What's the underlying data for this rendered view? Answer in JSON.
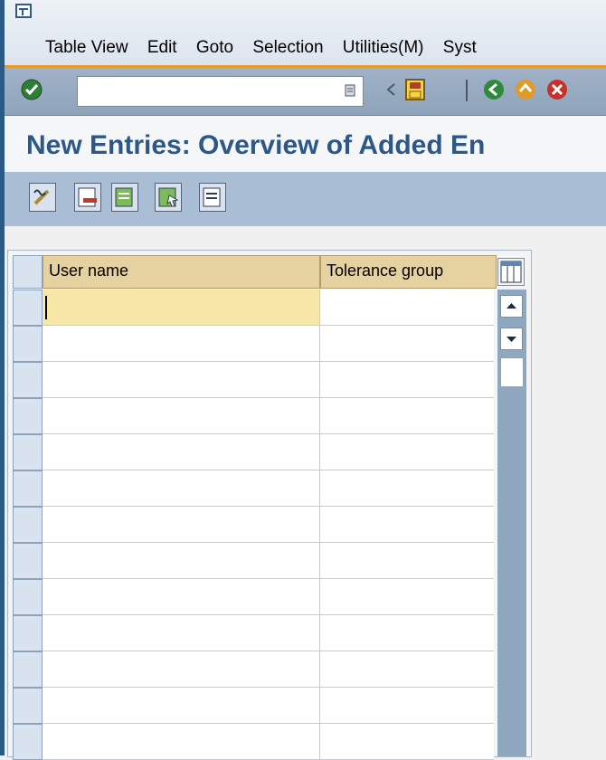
{
  "menu": {
    "items": [
      "Table View",
      "Edit",
      "Goto",
      "Selection",
      "Utilities(M)",
      "Syst"
    ]
  },
  "toolbar": {
    "command_field_value": "",
    "icons": [
      "enter-icon",
      "dropdown-icon",
      "back-arrow-icon",
      "save-icon",
      "back-icon",
      "exit-icon",
      "cancel-icon"
    ]
  },
  "page": {
    "title": "New Entries: Overview of Added En"
  },
  "app_toolbar": {
    "icons": [
      "change-display-icon",
      "delete-icon",
      "select-all-icon",
      "select-block-icon",
      "deselect-all-icon"
    ]
  },
  "table": {
    "columns": [
      "User name",
      "Tolerance group"
    ],
    "rows": [
      [
        "",
        ""
      ],
      [
        "",
        ""
      ],
      [
        "",
        ""
      ],
      [
        "",
        ""
      ],
      [
        "",
        ""
      ],
      [
        "",
        ""
      ],
      [
        "",
        ""
      ],
      [
        "",
        ""
      ],
      [
        "",
        ""
      ],
      [
        "",
        ""
      ],
      [
        "",
        ""
      ],
      [
        "",
        ""
      ],
      [
        "",
        ""
      ]
    ],
    "active_row": 0
  },
  "colors": {
    "title": "#2d5786",
    "header_bg": "#e6d2a0",
    "active_cell": "#f7e8a8",
    "toolbar": "#9fb2c8",
    "menu_accent": "#e69a2a"
  }
}
